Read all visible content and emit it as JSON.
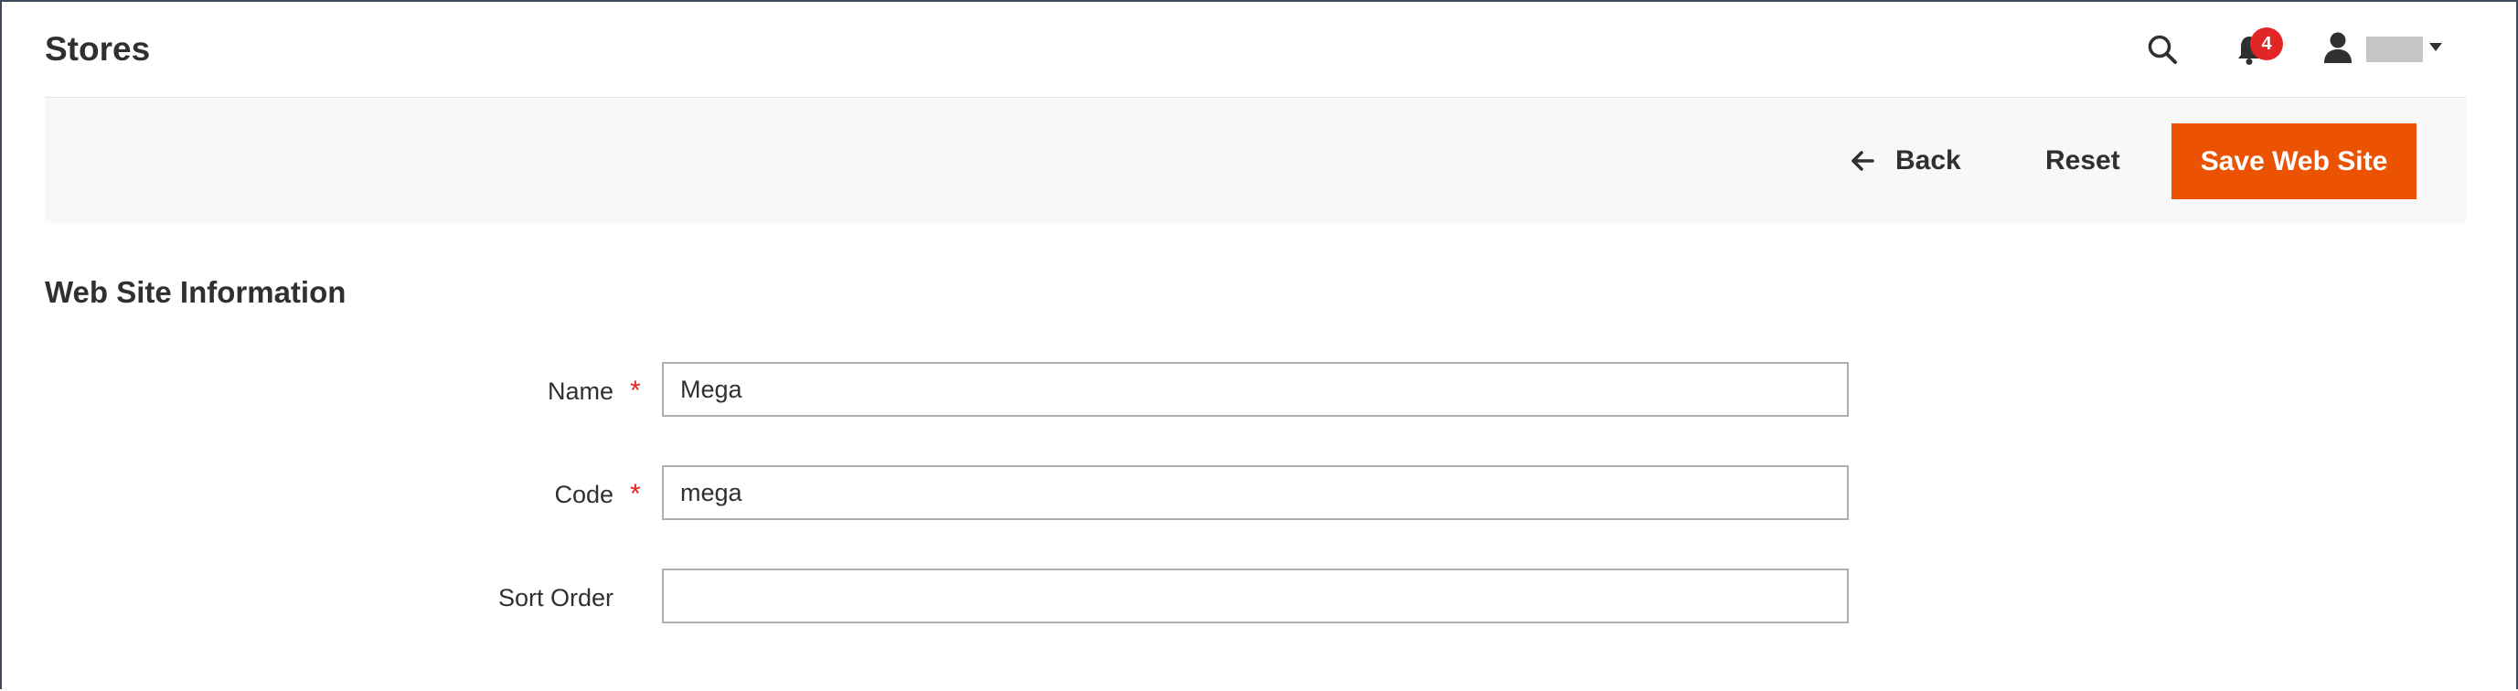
{
  "header": {
    "title": "Stores",
    "notifications_count": "4",
    "icons": {
      "search": "search-icon",
      "notifications": "bell-icon",
      "user": "user-icon",
      "user_menu": "caret-down-icon"
    }
  },
  "actions": {
    "back_label": "Back",
    "reset_label": "Reset",
    "save_label": "Save Web Site"
  },
  "section": {
    "title": "Web Site Information"
  },
  "form": {
    "name": {
      "label": "Name",
      "value": "Mega",
      "required_mark": "*"
    },
    "code": {
      "label": "Code",
      "value": "mega",
      "required_mark": "*"
    },
    "sort_order": {
      "label": "Sort Order",
      "value": ""
    }
  },
  "colors": {
    "primary_action": "#eb5202",
    "badge": "#e22626",
    "required": "#e22626",
    "action_bar_bg": "#f8f8f8"
  }
}
